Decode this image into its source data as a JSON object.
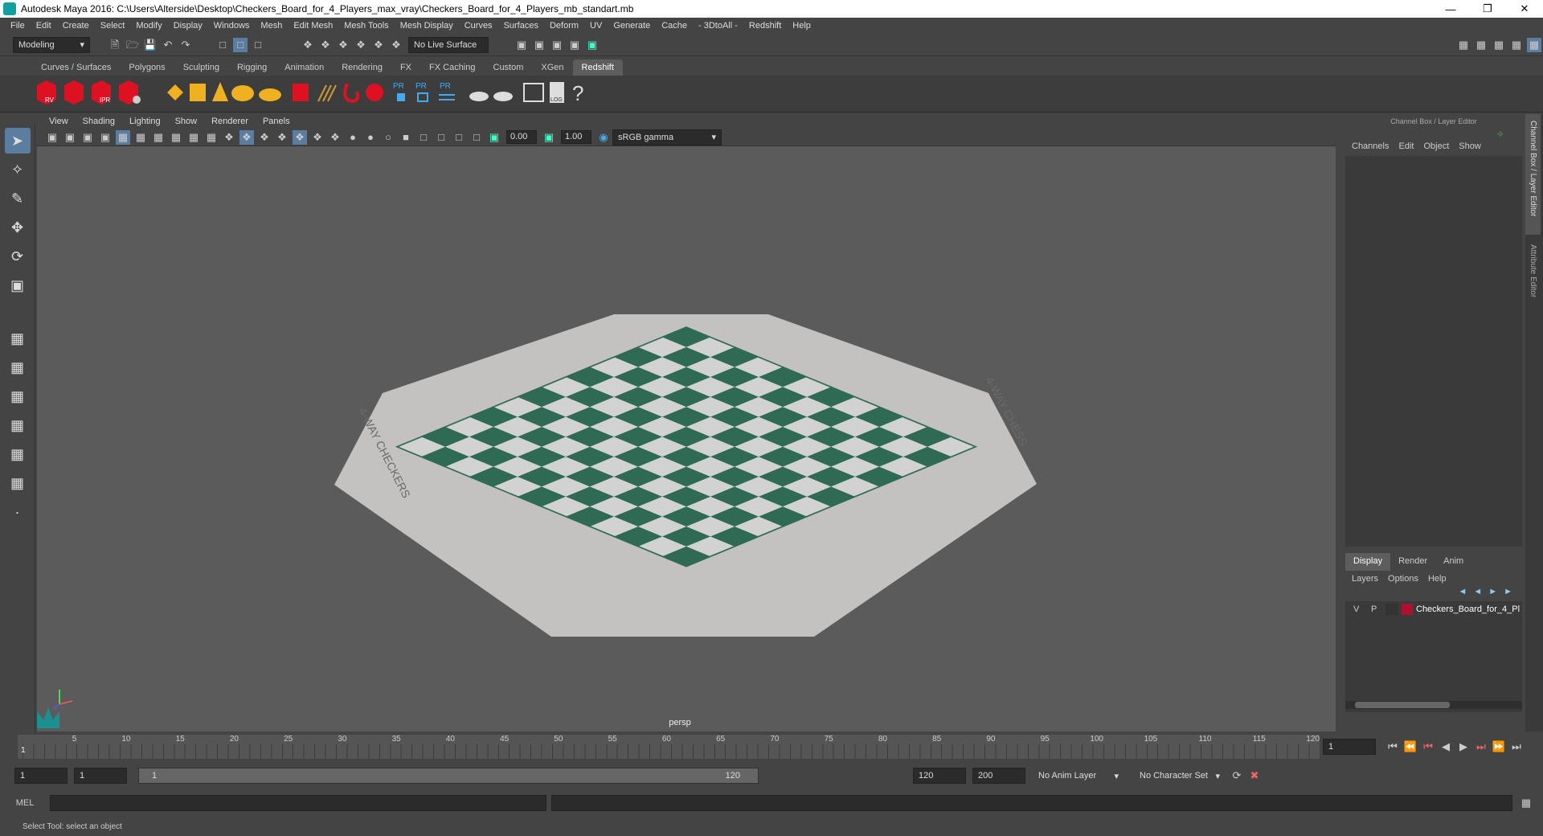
{
  "title": "Autodesk Maya 2016: C:\\Users\\Alterside\\Desktop\\Checkers_Board_for_4_Players_max_vray\\Checkers_Board_for_4_Players_mb_standart.mb",
  "menu": [
    "File",
    "Edit",
    "Create",
    "Select",
    "Modify",
    "Display",
    "Windows",
    "Mesh",
    "Edit Mesh",
    "Mesh Tools",
    "Mesh Display",
    "Curves",
    "Surfaces",
    "Deform",
    "UV",
    "Generate",
    "Cache",
    "- 3DtoAll -",
    "Redshift",
    "Help"
  ],
  "mode": "Modeling",
  "live_surface": "No Live Surface",
  "shelf_tabs": [
    "Curves / Surfaces",
    "Polygons",
    "Sculpting",
    "Rigging",
    "Animation",
    "Rendering",
    "FX",
    "FX Caching",
    "Custom",
    "XGen",
    "Redshift"
  ],
  "active_shelf": "Redshift",
  "shelf_labels": [
    "RV",
    "IPR",
    "PR",
    "PR",
    "PR",
    "LOG",
    "?"
  ],
  "viewport_menu": [
    "View",
    "Shading",
    "Lighting",
    "Show",
    "Renderer",
    "Panels"
  ],
  "exposure": "0.00",
  "gamma": "1.00",
  "color_space": "sRGB gamma",
  "camera_label": "persp",
  "board_text": [
    "4-WAY CHECKERS",
    "4-WAY CHESS"
  ],
  "channel_box": {
    "header": "Channel Box / Layer Editor",
    "menu": [
      "Channels",
      "Edit",
      "Object",
      "Show"
    ]
  },
  "layer_tabs": [
    "Display",
    "Render",
    "Anim"
  ],
  "layer_menu": [
    "Layers",
    "Options",
    "Help"
  ],
  "layer": {
    "v": "V",
    "p": "P",
    "name": "Checkers_Board_for_4_Pl"
  },
  "side_tabs": [
    "Channel Box / Layer Editor",
    "Attribute Editor"
  ],
  "ticks": [
    "5",
    "10",
    "15",
    "20",
    "25",
    "30",
    "35",
    "40",
    "45",
    "50",
    "55",
    "60",
    "65",
    "70",
    "75",
    "80",
    "85",
    "90",
    "95",
    "100",
    "105",
    "110",
    "115",
    "120"
  ],
  "timeline_start_marker": "1",
  "current_frame": "1",
  "range": {
    "start": "1",
    "playback_start": "1",
    "slider_left": "1",
    "slider_right": "120",
    "playback_end": "120",
    "end": "200"
  },
  "anim_layer": "No Anim Layer",
  "char_set": "No Character Set",
  "cmd_label": "MEL",
  "help_text": "Select Tool: select an object"
}
